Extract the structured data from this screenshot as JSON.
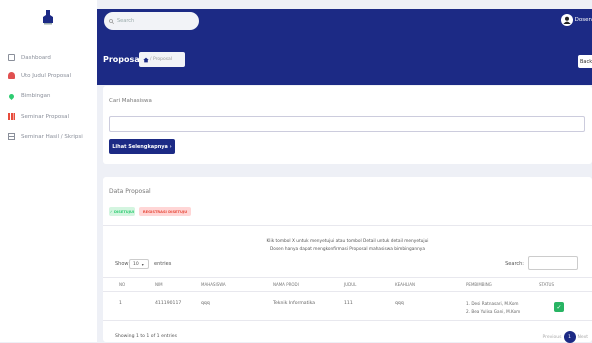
{
  "topbar": {
    "search_placeholder": "Search",
    "user_name": "Dosen"
  },
  "sidebar": {
    "items": [
      {
        "label": "Dashboard"
      },
      {
        "label": "Uto Judul Proposal"
      },
      {
        "label": "Bimbingan"
      },
      {
        "label": "Seminar Proposal"
      },
      {
        "label": "Seminar Hasil / Skripsi"
      }
    ]
  },
  "header": {
    "title": "Proposal",
    "breadcrumb": "/ Proposal",
    "back_label": "Back"
  },
  "search_card": {
    "label": "Cari Mahasiswa",
    "button_label": "Lihat Selengkapnya ›"
  },
  "data_card": {
    "title": "Data Proposal",
    "badges": [
      "✓ DISETUJUI",
      "REGISTRASI DISETUJU"
    ],
    "note_line1": "Klik tombol X untuk menyetujui atau tombol Detail untuk detail menyetujui",
    "note_line2": "Dosen hanya dapat mengkonfirmasi Proposal mahasiswa bimbingannya",
    "show_label": "Show",
    "show_value": "10",
    "entries_label": "entries",
    "search_label": "Search:",
    "columns": [
      "NO",
      "NIM",
      "MAHASISWA",
      "NAMA PRODI",
      "JUDUL",
      "KEAHLIAN",
      "PEMBIMBING",
      "STATUS"
    ],
    "rows": [
      {
        "no": "1",
        "nim": "411190117",
        "mahasiswa": "qqq",
        "prodi": "Teknik Informatika",
        "judul": "111",
        "keahlian": "qqq",
        "pembimbing1": "1. Desi Ratnasari, M.Kom",
        "pembimbing2": "2. Bea Yulisa Gani, M.Kom",
        "status": "✓"
      }
    ],
    "showing": "Showing 1 to 1 of 1 entries",
    "prev": "Previous",
    "page": "1",
    "next": "Next"
  }
}
